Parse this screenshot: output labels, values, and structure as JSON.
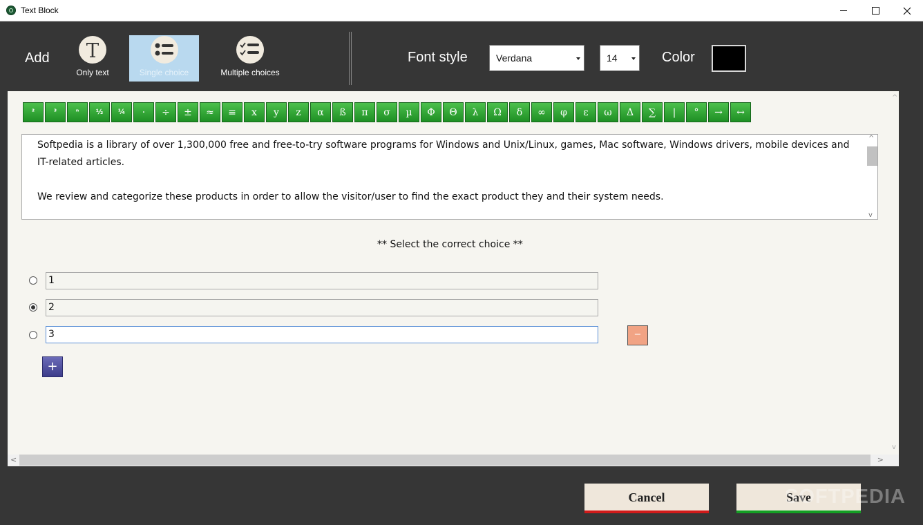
{
  "window": {
    "title": "Text Block"
  },
  "toolbar": {
    "add_label": "Add",
    "tools": [
      {
        "label": "Only text",
        "icon": "text-icon"
      },
      {
        "label": "Single choice",
        "icon": "single-choice-icon",
        "selected": true
      },
      {
        "label": "Multiple choices",
        "icon": "multiple-choices-icon"
      }
    ],
    "font_style_label": "Font style",
    "font_value": "Verdana",
    "size_value": "14",
    "color_label": "Color",
    "color_value": "#000000"
  },
  "symbols": [
    "²",
    "³",
    "ⁿ",
    "½",
    "¼",
    "·",
    "÷",
    "±",
    "≈",
    "≡",
    "x",
    "y",
    "z",
    "α",
    "ß",
    "π",
    "σ",
    "µ",
    "Φ",
    "Θ",
    "λ",
    "Ω",
    "δ",
    "∞",
    "φ",
    "ε",
    "ω",
    "Δ",
    "∑",
    "|",
    "°",
    "→",
    "↔"
  ],
  "text": {
    "paragraph1": "Softpedia is a library of over 1,300,000 free and free-to-try software programs for Windows and Unix/Linux, games, Mac software, Windows drivers, mobile devices and IT-related articles.",
    "paragraph2": "We review and categorize these products in order to allow the visitor/user to find the exact product they and their system needs."
  },
  "question": {
    "prompt": "** Select the correct choice **",
    "choices": [
      {
        "value": "1",
        "selected": false
      },
      {
        "value": "2",
        "selected": true
      },
      {
        "value": "3",
        "selected": false
      }
    ],
    "remove_label": "−",
    "add_label": "+"
  },
  "footer": {
    "cancel_label": "Cancel",
    "save_label": "Save",
    "watermark": "SOFTPEDIA"
  }
}
